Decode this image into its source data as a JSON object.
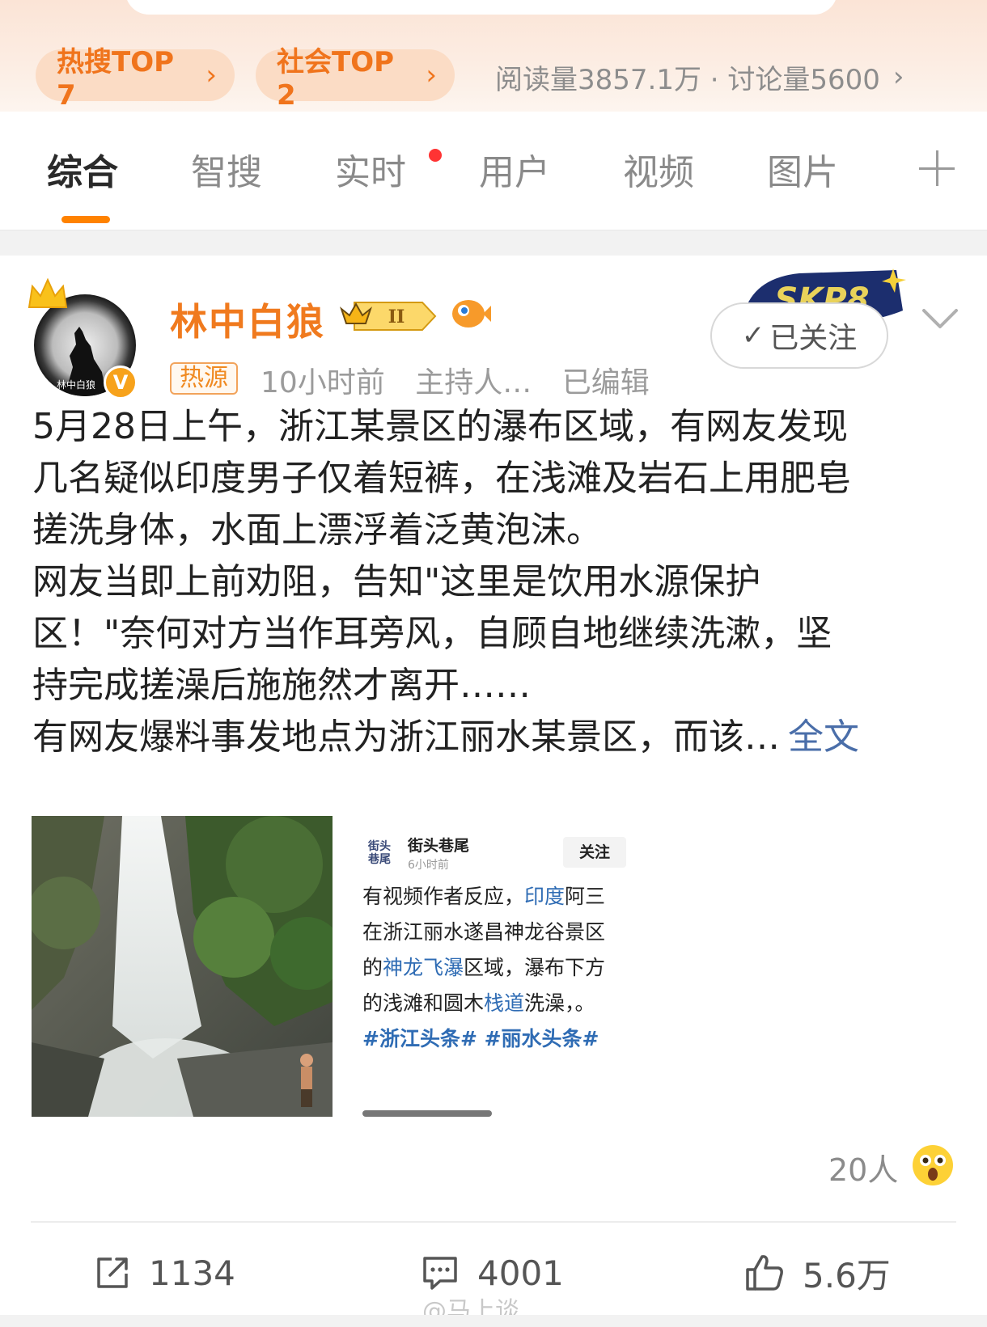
{
  "top": {
    "chips": [
      {
        "label": "热搜TOP 7",
        "arrow": "›"
      },
      {
        "label": "社会TOP 2",
        "arrow": "›"
      }
    ],
    "stats": "阅读量3857.1万 · 讨论量5600",
    "stats_chevron": "›"
  },
  "tabs": [
    "综合",
    "智搜",
    "实时",
    "用户",
    "视频",
    "图片"
  ],
  "post": {
    "username": "林中白狼",
    "rank_badge": "II",
    "avatar_caption": "林中白狼",
    "tag": "热源",
    "meta": [
      "10小时前",
      "主持人…",
      "已编辑"
    ],
    "follow_label": "已关注",
    "follow_check": "✓",
    "brand_deco": "SKP8",
    "lines": [
      "5月28日上午，浙江某景区的瀑布区域，有网友发现",
      "几名疑似印度男子仅着短裤，在浅滩及岩石上用肥皂",
      "搓洗身体，水面上漂浮着泛黄泡沫。",
      "网友当即上前劝阻，告知\"这里是饮用水源保护",
      "区！\"奈何对方当作耳旁风，自顾自地继续洗漱，坚",
      "持完成搓澡后施施然才离开……",
      "有网友爆料事发地点为浙江丽水某景区，而该…"
    ],
    "fulltext_label": "全文",
    "embedded": {
      "logo": "街头巷尾",
      "name": "街头巷尾",
      "time": "6小时前",
      "follow": "关注",
      "body_parts": [
        {
          "t": "有视频作者反应，",
          "k": "text"
        },
        {
          "t": "印度",
          "k": "link"
        },
        {
          "t": "阿三在浙江丽水遂昌神龙谷景区的",
          "k": "text"
        },
        {
          "t": "神龙飞瀑",
          "k": "link"
        },
        {
          "t": "区域，瀑布下方的浅滩和圆木",
          "k": "text"
        },
        {
          "t": "栈道",
          "k": "link"
        },
        {
          "t": "洗澡，。",
          "k": "text"
        }
      ],
      "hashtags": "#浙江头条# #丽水头条#"
    },
    "reaction_count": "20人",
    "actions": {
      "repost": "1134",
      "comment": "4001",
      "like": "5.6万"
    },
    "watermark": "@马上谈"
  }
}
